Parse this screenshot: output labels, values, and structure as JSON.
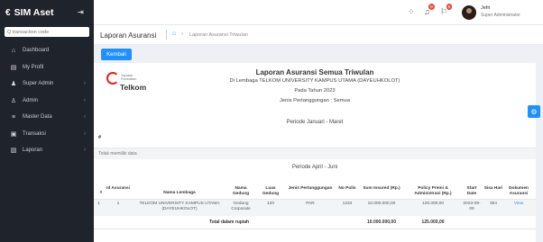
{
  "app": {
    "title": "SIM Aset"
  },
  "search": {
    "placeholder": "Q transaction code"
  },
  "sidebar": {
    "items": [
      {
        "label": "Dashboard"
      },
      {
        "label": "My Profil"
      },
      {
        "label": "Super Admin"
      },
      {
        "label": "Admin"
      },
      {
        "label": "Master Data"
      },
      {
        "label": "Transaksi"
      },
      {
        "label": "Laporan"
      }
    ]
  },
  "topbar": {
    "notif_badge_1": "8",
    "notif_badge_2": "8",
    "user_name": "Jefri",
    "user_role": "Super Administrator"
  },
  "header": {
    "page_title": "Laporan Asuransi",
    "breadcrumb": "Laporan Asuransi Triwulan"
  },
  "actions": {
    "back_label": "Kembali"
  },
  "report": {
    "logo_small": "Yayasan Pendidikan",
    "logo_text": "Telkom",
    "title": "Laporan Asuransi Semua Triwulan",
    "institution": "Di Lembaga TELKOM UNIVERSITY KAMPUS UTAMA (DAYEUHKOLOT)",
    "year": "Pada Tahun 2023",
    "coverage": "Jenis Pertanggungan : Semua",
    "period1": "Periode Januari - Maret",
    "period1_hash": "#",
    "empty_text": "Tidak memiliki data",
    "period2": "Periode April - Juni",
    "columns": [
      "#",
      "Id Asuransi",
      "Nama Lembaga",
      "Nama Gedung",
      "Luas Gedung",
      "Jenis Pertanggungan",
      "No Polis",
      "Sum Insured (Rp.)",
      "Policy Premi & Administrasi (Rp.)",
      "Start Date",
      "Sisa Hari",
      "Dokumen Asuransi"
    ],
    "rows": [
      {
        "no": "1",
        "id": "1",
        "lembaga": "TELKOM UNIVERSITY KAMPUS UTAMA (DAYEUHKOLOT)",
        "gedung": "Gedung Corporate",
        "luas": "120",
        "jenis": "PAR",
        "polis": "1234",
        "sum": "10.000.000,00",
        "premi": "125.000,00",
        "start": "2023-09-09",
        "sisa": "364",
        "dok": "View"
      }
    ],
    "total_label": "Total dalam rupiah",
    "total_sum": "10.000.000,00",
    "total_premi": "125.000,00"
  }
}
